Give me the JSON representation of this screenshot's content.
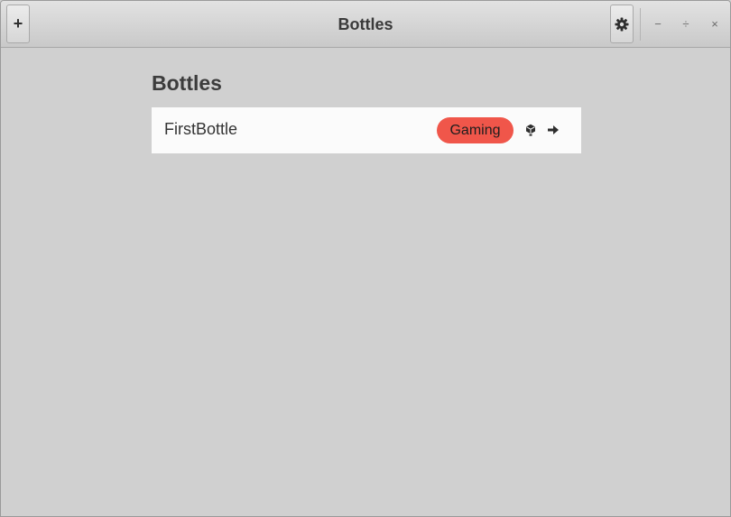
{
  "window": {
    "title": "Bottles",
    "add_label": "+",
    "controls": {
      "minimize": "−",
      "maximize": "÷",
      "close": "×"
    }
  },
  "headerbar": {
    "add_icon": "plus-icon",
    "prefs_icon": "gear-icon"
  },
  "main": {
    "section_title": "Bottles",
    "bottles": [
      {
        "name": "FirstBottle",
        "environment": "Gaming",
        "environment_color": "#f0564a",
        "actions": [
          "cube-icon",
          "arrow-right-icon"
        ]
      }
    ]
  }
}
